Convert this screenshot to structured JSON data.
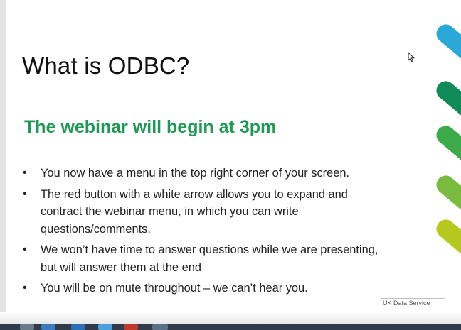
{
  "slide": {
    "title": "What is ODBC?",
    "subtitle": "The webinar will begin at 3pm",
    "bullets": [
      "You now have a menu in the top right corner of your screen.",
      "The red button with a white arrow allows you to expand and contract the webinar menu, in which you can write questions/comments.",
      "We won’t have time to answer questions while we are presenting, but will answer them at the end",
      "You will be on mute throughout – we can’t hear you."
    ],
    "bullet_symbol": "•",
    "footer_logo": "UK Data Service"
  },
  "colors": {
    "subtitle_green": "#1f9a56",
    "stripe_1": "#2aa8d8",
    "stripe_2": "#118a5a",
    "stripe_3": "#3daa4a",
    "stripe_4": "#78bb3e",
    "stripe_5": "#b4c81e"
  },
  "icons": {
    "cursor": "mouse-pointer-icon",
    "logo": "uk-data-service-logo-icon"
  }
}
